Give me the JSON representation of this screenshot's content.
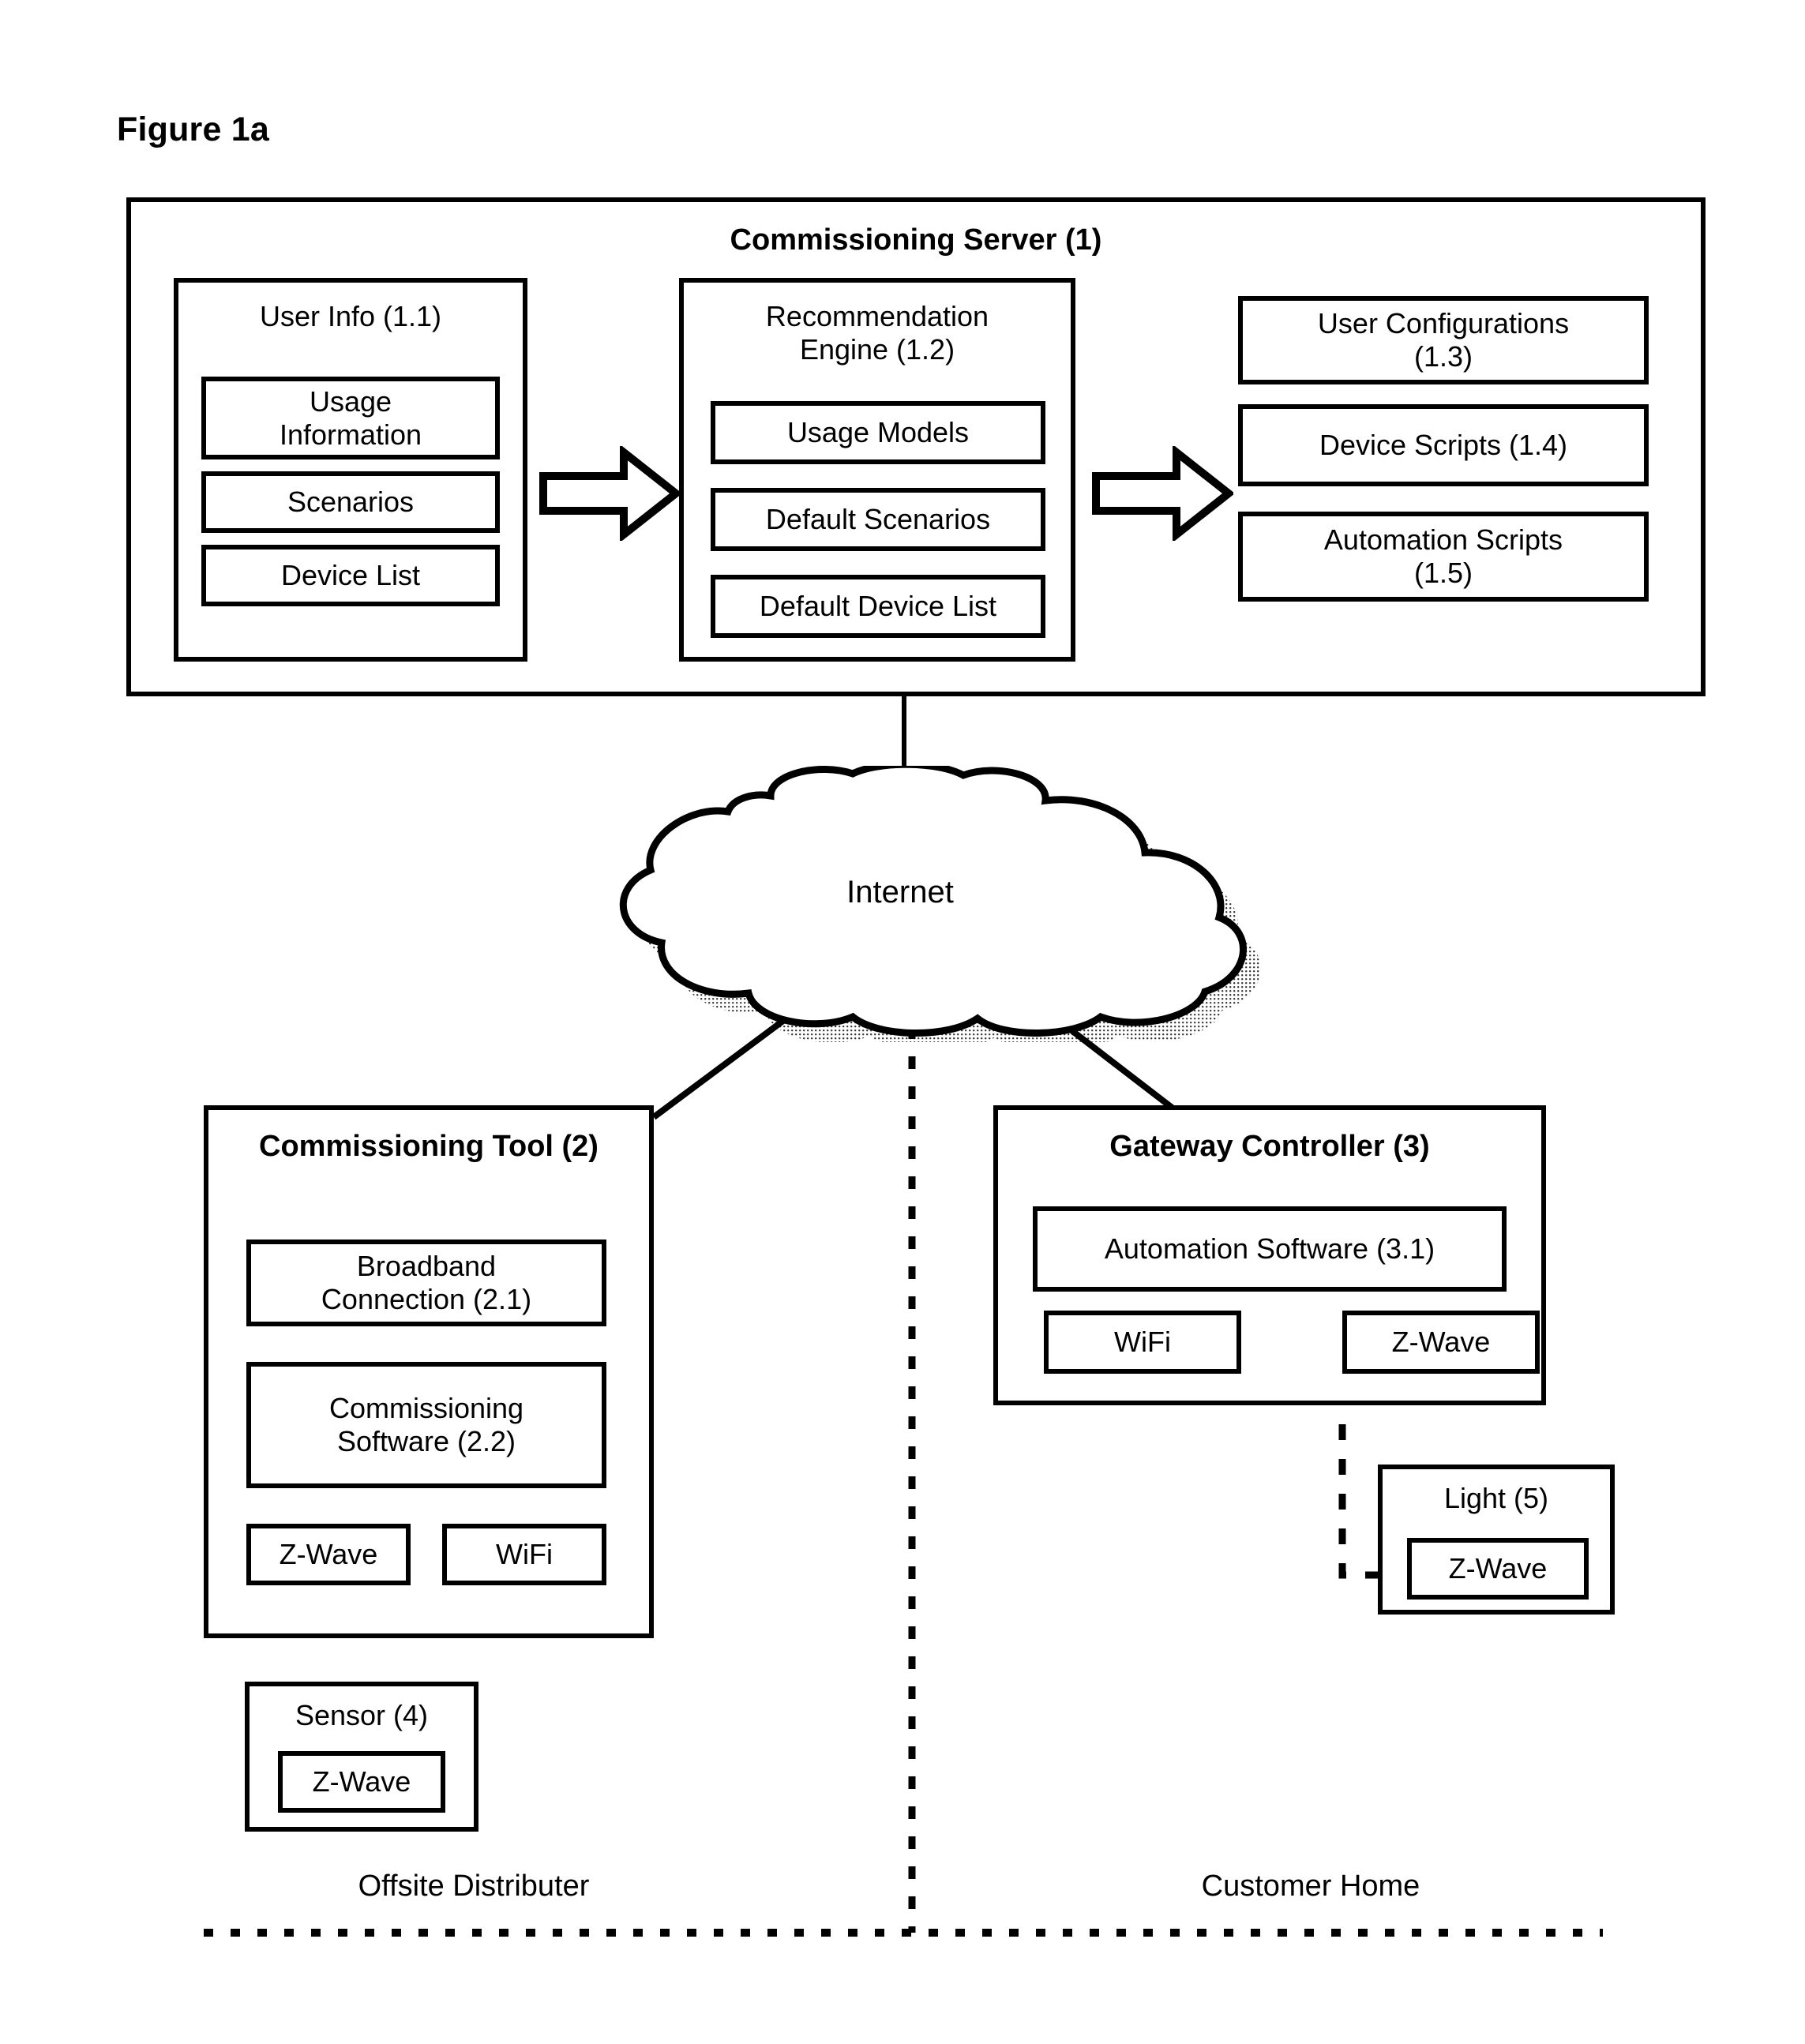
{
  "figure": {
    "title": "Figure 1a"
  },
  "server": {
    "title": "Commissioning Server (1)",
    "user_info": {
      "title": "User Info (1.1)",
      "items": [
        "Usage\nInformation",
        "Scenarios",
        "Device List"
      ]
    },
    "recommendation_engine": {
      "title": "Recommendation\nEngine  (1.2)",
      "items": [
        "Usage Models",
        "Default Scenarios",
        "Default Device List"
      ]
    },
    "outputs": [
      "User Configurations\n(1.3)",
      "Device Scripts (1.4)",
      "Automation Scripts\n(1.5)"
    ]
  },
  "cloud": {
    "label": "Internet"
  },
  "commissioning_tool": {
    "title": "Commissioning Tool (2)",
    "items": [
      "Broadband\nConnection (2.1)",
      "Commissioning\nSoftware (2.2)"
    ],
    "radios": [
      "Z-Wave",
      "WiFi"
    ]
  },
  "gateway_controller": {
    "title": "Gateway Controller (3)",
    "items": [
      "Automation Software (3.1)"
    ],
    "radios": [
      "WiFi",
      "Z-Wave"
    ]
  },
  "sensor": {
    "title": "Sensor (4)",
    "radio": "Z-Wave"
  },
  "light": {
    "title": "Light (5)",
    "radio": "Z-Wave"
  },
  "zones": {
    "left": "Offsite Distributer",
    "right": "Customer Home"
  },
  "colors": {
    "line": "#000000",
    "background": "#ffffff"
  }
}
